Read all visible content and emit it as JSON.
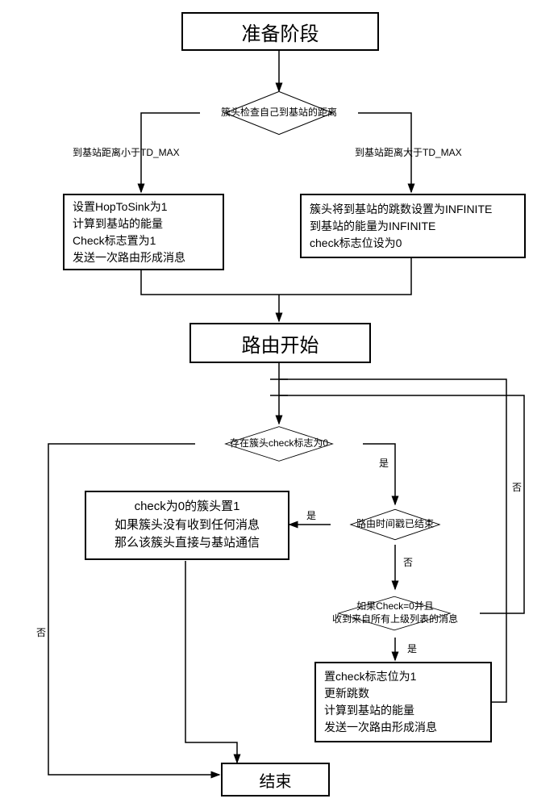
{
  "chart_data": {
    "type": "flowchart",
    "nodes": [
      {
        "id": "prep",
        "type": "process",
        "text": "准备阶段"
      },
      {
        "id": "d1",
        "type": "decision",
        "text": "簇头检查自己到基站的距离"
      },
      {
        "id": "left_action",
        "type": "process",
        "text": "设置HopToSink为1\n计算到基站的能量\nCheck标志置为1\n发送一次路由形成消息"
      },
      {
        "id": "right_action",
        "type": "process",
        "text": "簇头将到基站的跳数设置为INFINITE\n到基站的能量为INFINITE\ncheck标志位设为0"
      },
      {
        "id": "route_start",
        "type": "process",
        "text": "路由开始"
      },
      {
        "id": "d2",
        "type": "decision",
        "text": "存在簇头check标志为0"
      },
      {
        "id": "d3",
        "type": "decision",
        "text": "路由时间戳已结束"
      },
      {
        "id": "left_action2",
        "type": "process",
        "text": "check为0的簇头置1\n如果簇头没有收到任何消息\n那么该簇头直接与基站通信"
      },
      {
        "id": "d4",
        "type": "decision",
        "text": "如果Check=0并且\n收到来自所有上级列表的消息"
      },
      {
        "id": "right_action2",
        "type": "process",
        "text": "置check标志位为1\n更新跳数\n计算到基站的能量\n发送一次路由形成消息"
      },
      {
        "id": "end",
        "type": "process",
        "text": "结束"
      }
    ],
    "edges": [
      {
        "from": "prep",
        "to": "d1"
      },
      {
        "from": "d1",
        "to": "left_action",
        "label": "到基站距离小于TD_MAX"
      },
      {
        "from": "d1",
        "to": "right_action",
        "label": "到基站距离大于TD_MAX"
      },
      {
        "from": "left_action",
        "to": "route_start"
      },
      {
        "from": "right_action",
        "to": "route_start"
      },
      {
        "from": "route_start",
        "to": "d2"
      },
      {
        "from": "d2",
        "to": "d3",
        "label": "是"
      },
      {
        "from": "d2",
        "to": "end",
        "label": "否"
      },
      {
        "from": "d3",
        "to": "left_action2",
        "label": "是"
      },
      {
        "from": "d3",
        "to": "d4",
        "label": "否"
      },
      {
        "from": "d4",
        "to": "right_action2",
        "label": "是"
      },
      {
        "from": "d4",
        "to": "d2",
        "label": "否"
      },
      {
        "from": "right_action2",
        "to": "d2"
      },
      {
        "from": "left_action2",
        "to": "end"
      }
    ]
  },
  "nodes": {
    "prep": "准备阶段",
    "d1": "簇头检查自己到基站的距离",
    "left_action_l1": "设置HopToSink为1",
    "left_action_l2": "计算到基站的能量",
    "left_action_l3": "Check标志置为1",
    "left_action_l4": "发送一次路由形成消息",
    "right_action_l1": "簇头将到基站的跳数设置为INFINITE",
    "right_action_l2": "到基站的能量为INFINITE",
    "right_action_l3": "check标志位设为0",
    "route_start": "路由开始",
    "d2": "存在簇头check标志为0",
    "d3": "路由时间戳已结束",
    "left_action2_l1": "check为0的簇头置1",
    "left_action2_l2": "如果簇头没有收到任何消息",
    "left_action2_l3": "那么该簇头直接与基站通信",
    "d4_l1": "如果Check=0并且",
    "d4_l2": "收到来自所有上级列表的消息",
    "right_action2_l1": "置check标志位为1",
    "right_action2_l2": "更新跳数",
    "right_action2_l3": "计算到基站的能量",
    "right_action2_l4": "发送一次路由形成消息",
    "end": "结束"
  },
  "labels": {
    "d1_left": "到基站距离小于TD_MAX",
    "d1_right": "到基站距离大于TD_MAX",
    "yes": "是",
    "no": "否"
  }
}
